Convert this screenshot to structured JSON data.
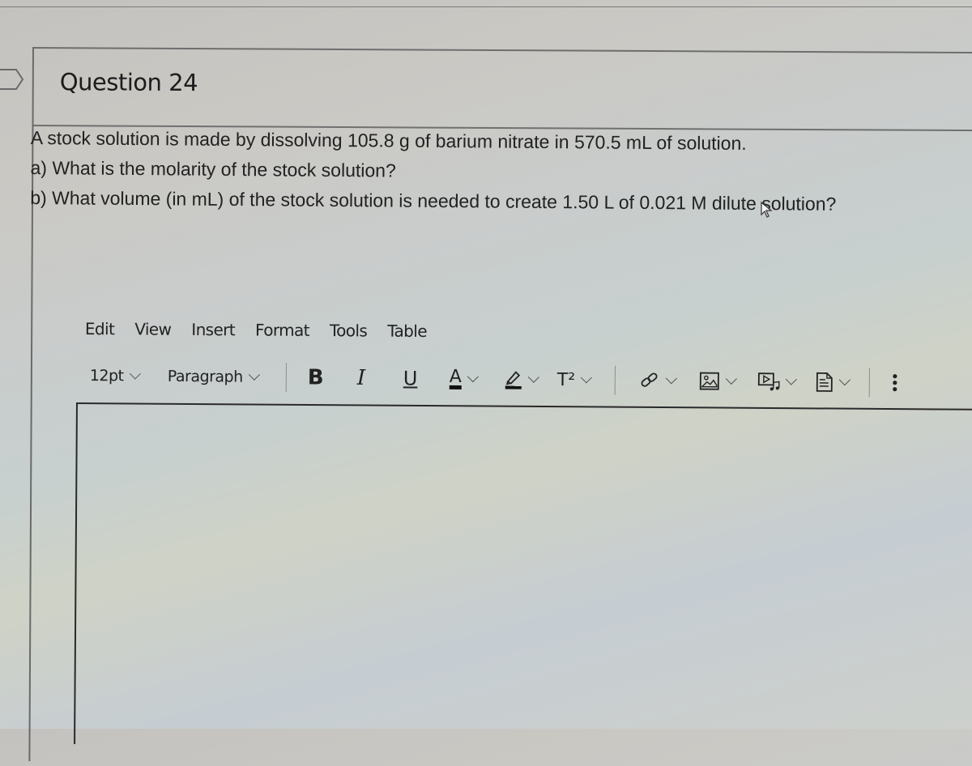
{
  "question": {
    "title": "Question 24",
    "lines": [
      "A stock solution is made by dissolving 105.8 g of barium nitrate in 570.5 mL of solution.",
      "a) What is the molarity of the stock solution?",
      "b) What volume (in mL) of the stock solution is needed to create 1.50 L of 0.021 M dilute solution?"
    ]
  },
  "editor": {
    "menu": [
      "Edit",
      "View",
      "Insert",
      "Format",
      "Tools",
      "Table"
    ],
    "font_size": "12pt",
    "block_format": "Paragraph",
    "toolbar_icons": {
      "bold": "B",
      "italic": "I",
      "underline": "U",
      "text_color": "A",
      "superscript": "T²"
    },
    "content": ""
  }
}
